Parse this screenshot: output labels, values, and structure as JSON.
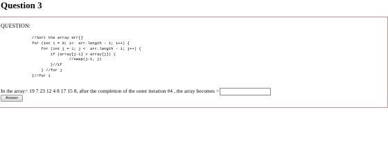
{
  "page": {
    "title": "Question 3"
  },
  "question": {
    "label": "QUESTION:",
    "code_lines": [
      "//Sort the array arr[]",
      "for (int i = 0; i<  arr.length - 1; i++) {",
      "    for (int j = 1; j <  arr.length - i; j++) {",
      "        if (array[j-1] > array[j]) {",
      "                //swap(j-1, j)",
      "        }//if",
      "    } //for j",
      "}//for i"
    ],
    "prompt": "In the array= 19 7 23 12 4 8 17 15 8, after the completion of the outer iteration #4 , the array becomes =",
    "answer_value": "",
    "submit_label": "Answer"
  }
}
